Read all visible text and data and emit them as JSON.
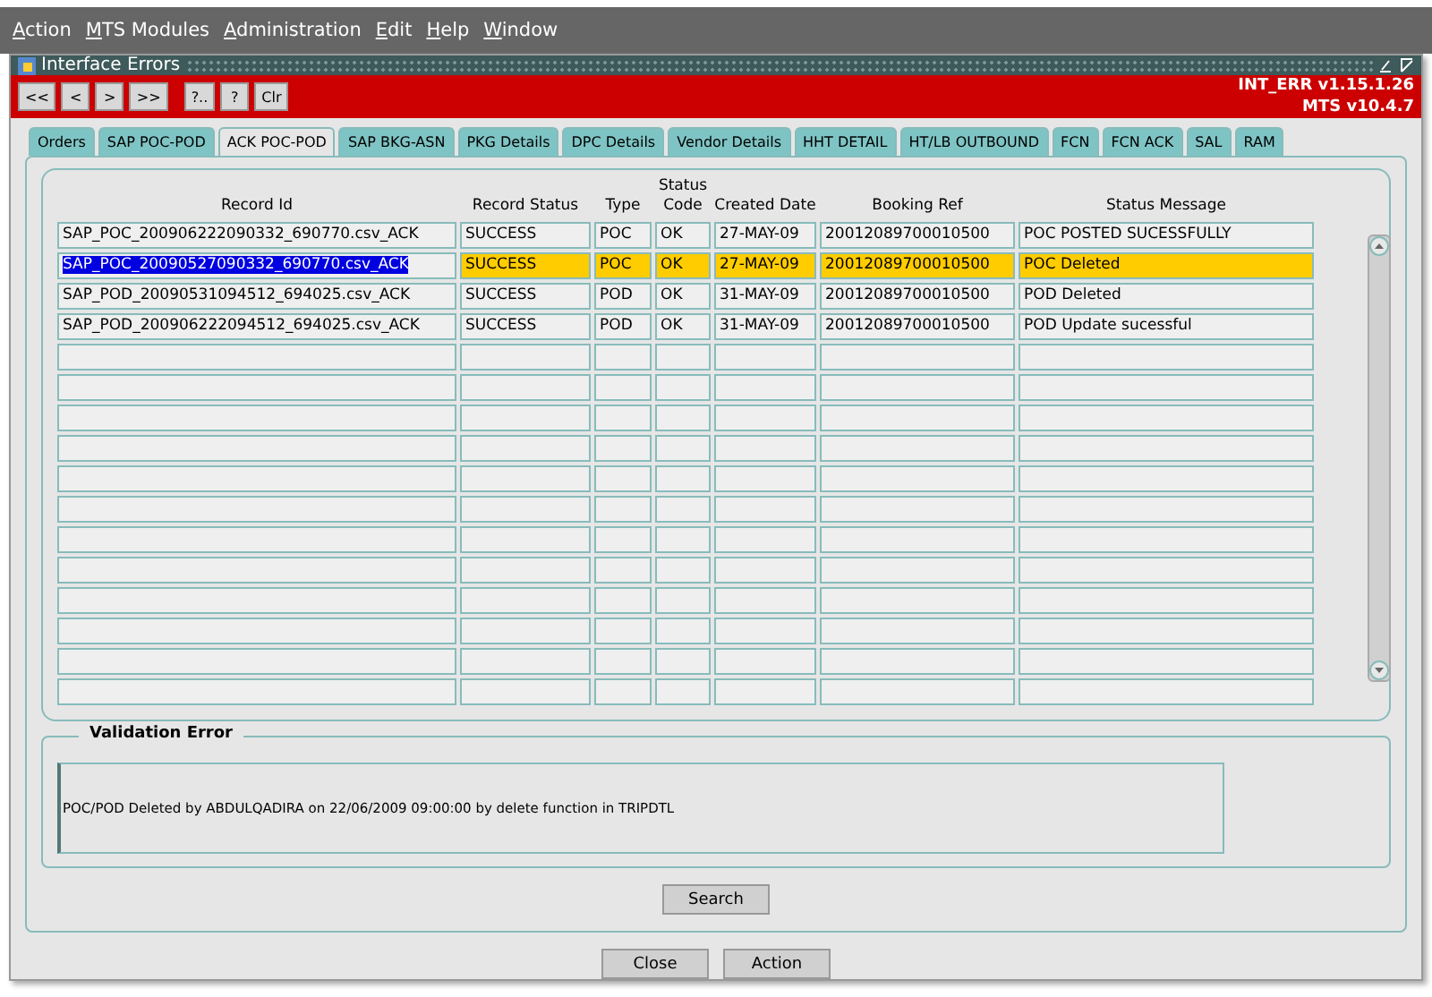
{
  "menu": [
    "Action",
    "MTS Modules",
    "Administration",
    "Edit",
    "Help",
    "Window"
  ],
  "window": {
    "title": "Interface Errors"
  },
  "toolbar": {
    "buttons": [
      "<<",
      "<",
      ">",
      ">>",
      "?..",
      "?",
      "Clr"
    ],
    "version": [
      "INT_ERR v1.15.1.26",
      "MTS v10.4.7"
    ]
  },
  "tabs": [
    {
      "label": "Orders",
      "selected": false
    },
    {
      "label": "SAP POC-POD",
      "selected": false
    },
    {
      "label": "ACK POC-POD",
      "selected": true
    },
    {
      "label": "SAP BKG-ASN",
      "selected": false
    },
    {
      "label": "PKG Details",
      "selected": false
    },
    {
      "label": "DPC Details",
      "selected": false
    },
    {
      "label": "Vendor Details",
      "selected": false
    },
    {
      "label": "HHT DETAIL",
      "selected": false
    },
    {
      "label": "HT/LB OUTBOUND",
      "selected": false
    },
    {
      "label": "FCN",
      "selected": false
    },
    {
      "label": "FCN ACK",
      "selected": false
    },
    {
      "label": "SAL",
      "selected": false
    },
    {
      "label": "RAM",
      "selected": false
    }
  ],
  "table": {
    "columns": [
      "Record Id",
      "Record Status",
      "Type",
      "Status Code",
      "Created Date",
      "Booking Ref",
      "Status Message"
    ],
    "rows": [
      {
        "cells": [
          "SAP_POC_200906222090332_690770.csv_ACK",
          "SUCCESS",
          "POC",
          "OK",
          "27-MAY-09",
          "20012089700010500",
          "POC POSTED SUCESSFULLY"
        ],
        "selected": false
      },
      {
        "cells": [
          "SAP_POC_20090527090332_690770.csv_ACK",
          "SUCCESS",
          "POC",
          "OK",
          "27-MAY-09",
          "20012089700010500",
          "POC Deleted"
        ],
        "selected": true
      },
      {
        "cells": [
          "SAP_POD_20090531094512_694025.csv_ACK",
          "SUCCESS",
          "POD",
          "OK",
          "31-MAY-09",
          "20012089700010500",
          "POD Deleted"
        ],
        "selected": false
      },
      {
        "cells": [
          "SAP_POD_200906222094512_694025.csv_ACK",
          "SUCCESS",
          "POD",
          "OK",
          "31-MAY-09",
          "20012089700010500",
          "POD Update sucessful"
        ],
        "selected": false
      }
    ]
  },
  "validation": {
    "title": "Validation Error",
    "message": "POC/POD Deleted by ABDULQADIRA on 22/06/2009 09:00:00 by delete function in TRIPDTL"
  },
  "search_button": "Search",
  "buttons": [
    "Close",
    "Action"
  ]
}
